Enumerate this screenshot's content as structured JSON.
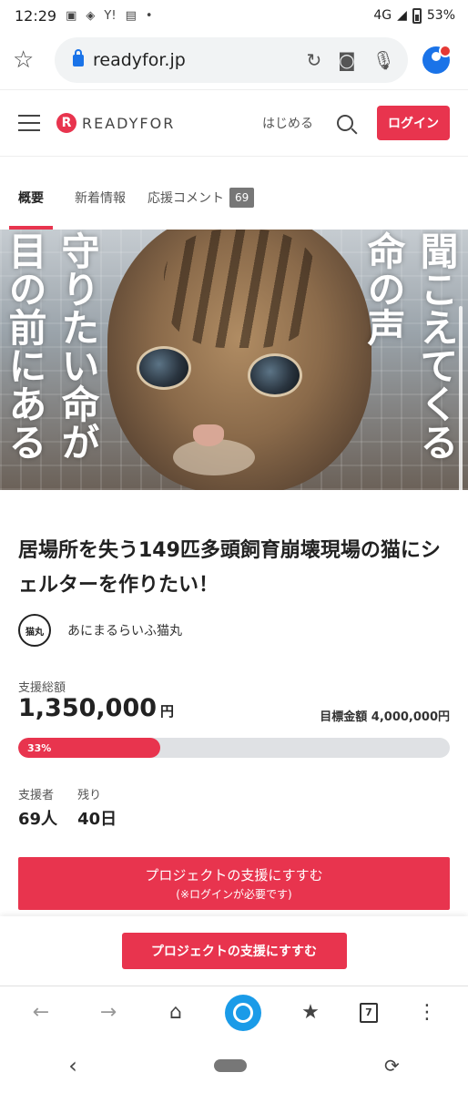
{
  "status": {
    "time": "12:29",
    "left_icons": [
      "image-icon",
      "location-icon",
      "Y!",
      "news-icon",
      "•"
    ],
    "network": "4G",
    "battery": "53%"
  },
  "browser": {
    "url": "readyfor.jp"
  },
  "header": {
    "logo_text": "READYFOR",
    "logo_mark": "R",
    "start_label": "はじめる",
    "login_label": "ログイン"
  },
  "tabs": [
    {
      "label": "概要",
      "active": true
    },
    {
      "label": "新着情報"
    },
    {
      "label": "応援コメント",
      "count": "69"
    }
  ],
  "hero": {
    "lines": [
      "目の前にある",
      "守りたい命が",
      "命の声",
      "聞こえてくる"
    ]
  },
  "project": {
    "title": "居場所を失う149匹多頭飼育崩壊現場の猫にシェルターを作りたい！",
    "owner_name": "あにまるらいふ猫丸",
    "owner_icon_text": "猫丸",
    "total_label": "支援総額",
    "total_value": "1,350,000",
    "total_unit": "円",
    "goal_label": "目標金額 4,000,000円",
    "progress_label": "33%",
    "progress_fraction": 0.33,
    "supporters_label": "支援者",
    "supporters_value": "69人",
    "remaining_label": "残り",
    "remaining_value": "40日",
    "cta_line1": "プロジェクトの支援にすすむ",
    "cta_line2": "(※ログインが必要です)",
    "sticky_cta": "プロジェクトの支援にすすむ"
  },
  "browser_nav": {
    "tabs_count": "7"
  },
  "colors": {
    "accent": "#e8344e",
    "browser_blue": "#1a73e8"
  }
}
